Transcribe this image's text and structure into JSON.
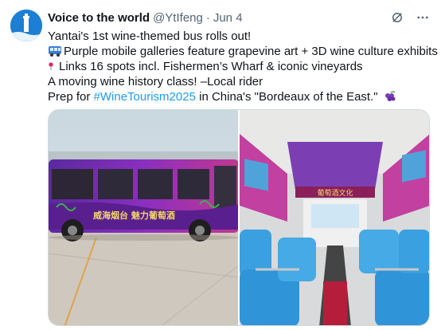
{
  "author": {
    "display_name": "Voice to the world",
    "handle": "@YtIfeng",
    "separator": "·",
    "date": "Jun 4",
    "avatar_icon": "lighthouse-avatar-icon"
  },
  "actions": {
    "grok_icon": "grok-icon",
    "more_icon": "more-options-icon"
  },
  "tweet": {
    "line1": "Yantai's 1st wine-themed bus rolls out!",
    "line2": "Purple mobile galleries feature grapevine art + 3D wine culture exhibits",
    "line3": "Links 16 spots incl. Fishermen’s Wharf & iconic vineyards",
    "line4": "A moving wine history class! –Local rider",
    "line5_prefix": "Prep for ",
    "line5_hashtag": "#WineTourism2025",
    "line5_suffix": " in China's \"Bordeaux of the East.\"",
    "emoji_bus": "bus-emoji",
    "emoji_pin": "round-pushpin-emoji",
    "emoji_grapes": "grapes-emoji"
  },
  "media": [
    {
      "name": "bus-exterior-photo",
      "bus_banner": "威海烟台 魅力葡萄酒"
    },
    {
      "name": "bus-interior-photo",
      "interior_banner": "葡萄酒文化"
    }
  ],
  "colors": {
    "link": "#1d9bf0",
    "secondary_text": "#536471",
    "bus_purple": "#7b2fbe",
    "seat_blue": "#3aa0e0"
  }
}
